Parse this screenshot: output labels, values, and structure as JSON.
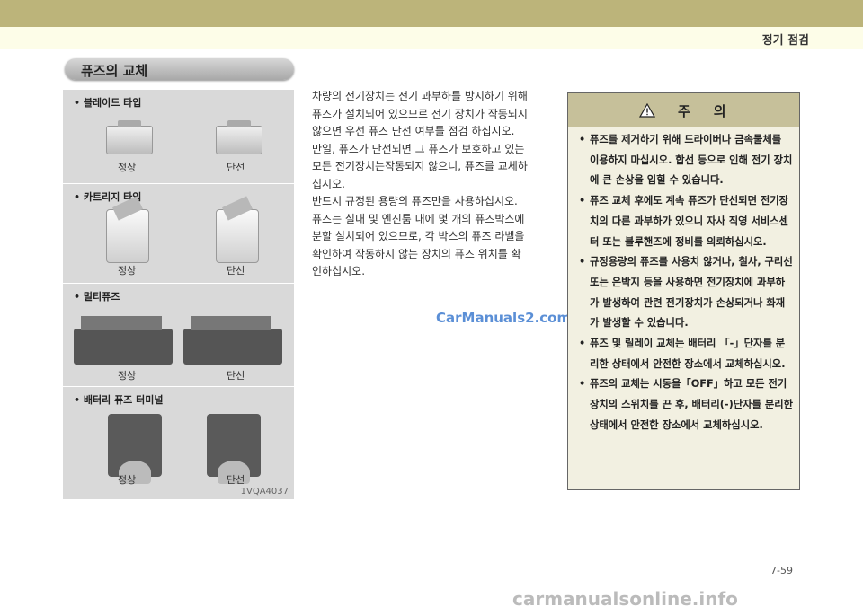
{
  "header": {
    "chapter_title": "정기 점검"
  },
  "section": {
    "title": "퓨즈의 교체"
  },
  "fuse_panel": {
    "sections": [
      {
        "heading": "블레이드 타입",
        "normal": "정상",
        "blown": "단선"
      },
      {
        "heading": "카트리지 타입",
        "normal": "정상",
        "blown": "단선"
      },
      {
        "heading": "멀티퓨즈",
        "normal": "정상",
        "blown": "단선"
      },
      {
        "heading": "배터리 퓨즈 터미널",
        "normal": "정상",
        "blown": "단선"
      }
    ],
    "photo_code": "1VQA4037"
  },
  "body": {
    "paragraphs": [
      "차량의 전기장치는 전기 과부하를 방지하기 위해",
      "퓨즈가 설치되어 있으므로 전기 장치가 작동되지",
      "않으면 우선 퓨즈 단선 여부를 점검 하십시오.",
      "만일, 퓨즈가 단선되면 그 퓨즈가 보호하고 있는",
      "모든 전기장치는작동되지 않으니, 퓨즈를 교체하",
      "십시오.",
      "반드시 규정된 용량의 퓨즈만을 사용하십시오.",
      "퓨즈는 실내 및 엔진룸 내에 몇 개의 퓨즈박스에",
      "분할 설치되어  있으므로, 각 박스의 퓨즈 라벨을",
      "확인하여 작동하지 않는 장치의 퓨즈 위치를 확",
      "인하십시오."
    ]
  },
  "watermark": "CarManuals2.com",
  "caution": {
    "title": "주의",
    "items": [
      "퓨즈를 제거하기 위해 드라이버나 금속물체를 이용하지 마십시오.  합선 등으로 인해 전기 장치에 큰 손상을 입힐 수 있습니다.",
      "퓨즈 교체 후에도 계속 퓨즈가 단선되면 전기장치의 다른 과부하가 있으니 자사 직영 서비스센터 또는 블루핸즈에 정비를 의뢰하십시오.",
      "규정용량의 퓨즈를 사용치 않거나, 철사, 구리선 또는 은박지 등을 사용하면 전기장치에 과부하가 발생하여 관련 전기장치가 손상되거나 화재가 발생할 수 있습니다.",
      "퓨즈 및 릴레이 교체는 배터리 「-」단자를 분리한 상태에서 안전한 장소에서 교체하십시오.",
      "퓨즈의 교체는 시동을「OFF」하고  모든 전기장치의 스위치를 끈 후, 배터리(-)단자를 분리한 상태에서 안전한 장소에서 교체하십시오."
    ]
  },
  "page_number": "7-59",
  "footer": "carmanualsonline.info"
}
